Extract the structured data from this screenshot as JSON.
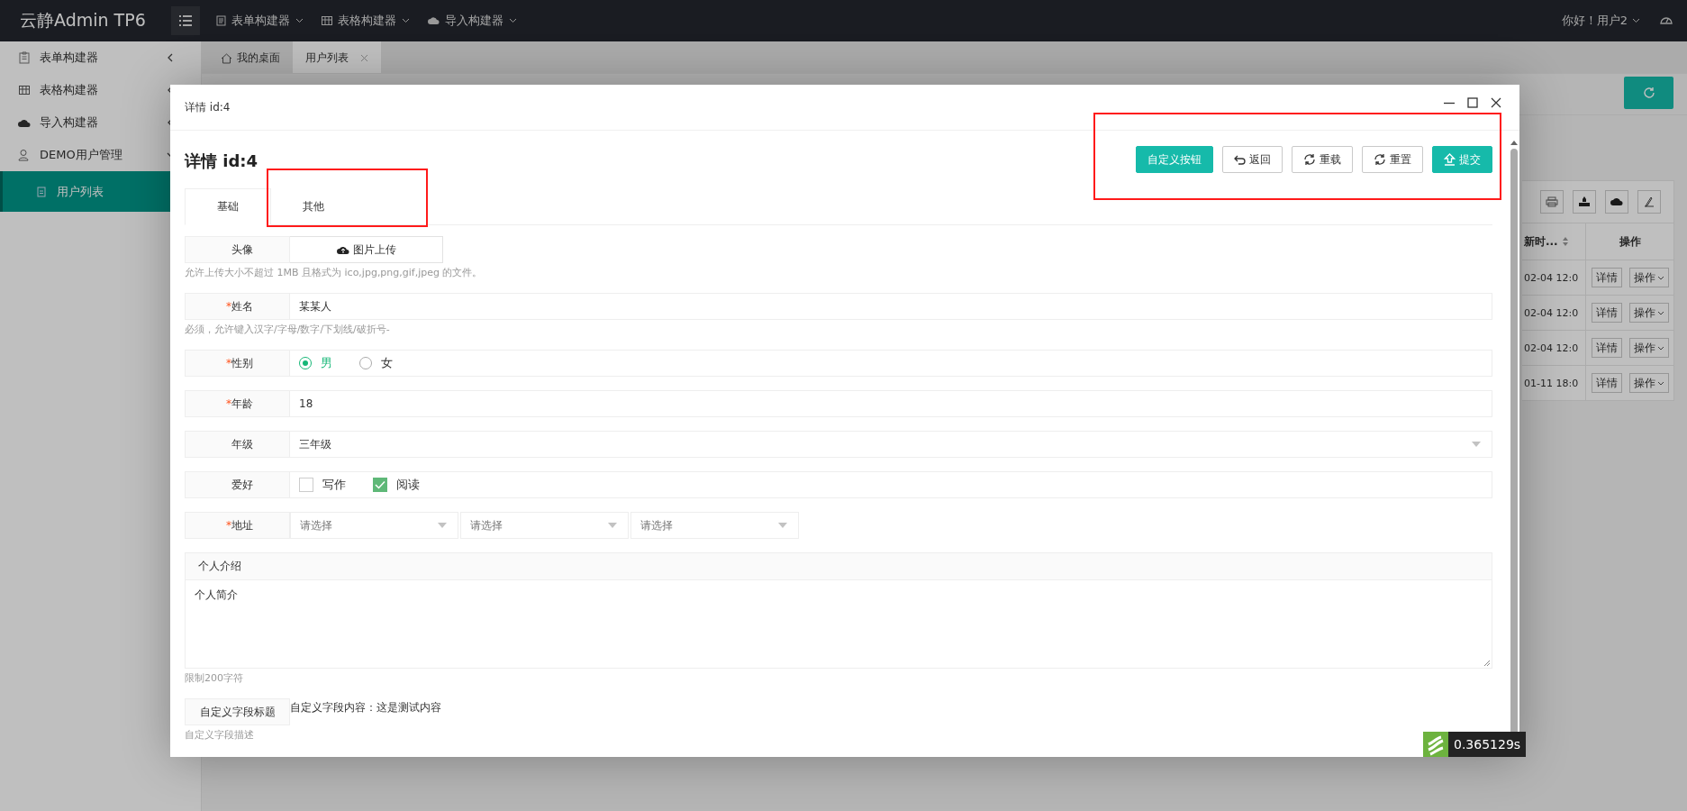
{
  "header": {
    "logo": "云静Admin TP6",
    "menus": [
      {
        "label": "表单构建器"
      },
      {
        "label": "表格构建器"
      },
      {
        "label": "导入构建器"
      }
    ],
    "greeting": "你好！用户2"
  },
  "sidebar": {
    "items": [
      {
        "label": "表单构建器",
        "selected": false,
        "expanded": false
      },
      {
        "label": "表格构建器",
        "selected": false,
        "expanded": false
      },
      {
        "label": "导入构建器",
        "selected": false,
        "expanded": false
      },
      {
        "label": "DEMO用户管理",
        "selected": false,
        "expanded": true,
        "children": [
          {
            "label": "用户列表",
            "selected": true
          }
        ]
      }
    ]
  },
  "page_tabs": [
    {
      "label": "我的桌面",
      "selected": false,
      "closable": false
    },
    {
      "label": "用户列表",
      "selected": true,
      "closable": true
    }
  ],
  "table": {
    "columns": [
      "新时...",
      "操作"
    ],
    "rows": [
      {
        "cells": [
          "02-04 12:0",
          "详情",
          "操作"
        ]
      },
      {
        "cells": [
          "02-04 12:0",
          "详情",
          "操作"
        ]
      },
      {
        "cells": [
          "02-04 12:0",
          "详情",
          "操作"
        ]
      },
      {
        "cells": [
          "01-11 18:0",
          "详情",
          "操作"
        ]
      }
    ]
  },
  "modal": {
    "title": "详情 id:4",
    "heading": "详情 id:4",
    "buttons": [
      {
        "label": "自定义按钮",
        "kind": "primary"
      },
      {
        "label": "返回",
        "kind": "default"
      },
      {
        "label": "重载",
        "kind": "default"
      },
      {
        "label": "重置",
        "kind": "default"
      },
      {
        "label": "提交",
        "kind": "primary"
      }
    ],
    "tabs": [
      {
        "label": "基础",
        "selected": true
      },
      {
        "label": "其他",
        "selected": false
      }
    ],
    "fields": [
      {
        "kind": "upload",
        "label": "头像",
        "button": "图片上传",
        "hint": "允许上传大小不超过 1MB 且格式为 ico,jpg,png,gif,jpeg 的文件。"
      },
      {
        "kind": "text",
        "label": "姓名",
        "mark": "*",
        "value": "某某人",
        "hint": "必须，允许键入汉字/字母/数字/下划线/破折号-"
      },
      {
        "kind": "radio",
        "label": "性别",
        "mark": "*",
        "options": [
          {
            "label": "男",
            "selected": true
          },
          {
            "label": "女",
            "selected": false
          }
        ]
      },
      {
        "kind": "text",
        "label": "年龄",
        "mark": "*",
        "value": "18"
      },
      {
        "kind": "select",
        "label": "年级",
        "value": "三年级"
      },
      {
        "kind": "checkbox",
        "label": "爱好",
        "options": [
          {
            "label": "写作",
            "checked": false
          },
          {
            "label": "阅读",
            "checked": true
          }
        ]
      },
      {
        "kind": "cascade",
        "label": "地址",
        "mark": "*",
        "placeholders": [
          "请选择",
          "请选择",
          "请选择"
        ]
      }
    ],
    "intro": {
      "label": "个人介绍",
      "value": "个人简介",
      "hint": "限制200字符"
    },
    "custom": {
      "label": "自定义字段标题",
      "content": "自定义字段内容：这是测试内容",
      "hint": "自定义字段描述"
    }
  },
  "timer": "0.365129s"
}
